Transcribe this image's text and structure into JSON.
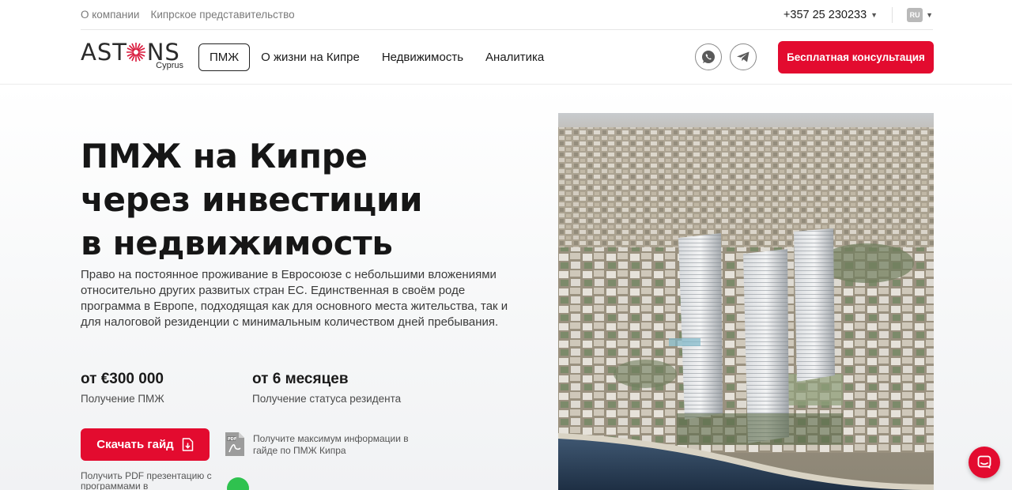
{
  "topbar": {
    "links": [
      "О компании",
      "Кипрское представительство"
    ],
    "phone": "+357 25 230233",
    "language": "RU"
  },
  "header": {
    "logo_main": "ASTONS",
    "logo_sub": "Cyprus",
    "nav_active": "ПМЖ",
    "nav_items": [
      "О жизни на Кипре",
      "Недвижимость",
      "Аналитика"
    ],
    "cta_label": "Бесплатная консультация"
  },
  "hero": {
    "title_lines": [
      "ПМЖ на Кипре",
      "через инвестиции",
      "в недвижимость"
    ],
    "description": "Право на постоянное проживание в Евросоюзе с небольшими вложениями относительно других развитых стран ЕС. Единственная в своём роде программа в Европе, подходящая как для основного места жительства, так и для налоговой резиденции с минимальным количеством дней пребывания.",
    "stats": [
      {
        "value": "от €300 000",
        "label": "Получение ПМЖ"
      },
      {
        "value": "от 6 месяцев",
        "label": "Получение статуса резидента"
      }
    ],
    "guide_button": "Скачать гайд",
    "pdf_info": "Получите максимум информации в гайде по ПМЖ Кипра",
    "pdf_note": "Получить PDF презентацию с программами в"
  },
  "colors": {
    "brand_red": "#e30b2f",
    "text_dark": "#1a1a1a",
    "text_muted": "#7a7a7a"
  },
  "icons": {
    "phone_dropdown": "chevron-down-icon",
    "language_dropdown": "chevron-down-icon",
    "social_1": "whatsapp-icon",
    "social_2": "telegram-icon",
    "guide": "download-document-icon",
    "pdf": "pdf-file-icon",
    "chat": "chat-bubble-icon"
  }
}
